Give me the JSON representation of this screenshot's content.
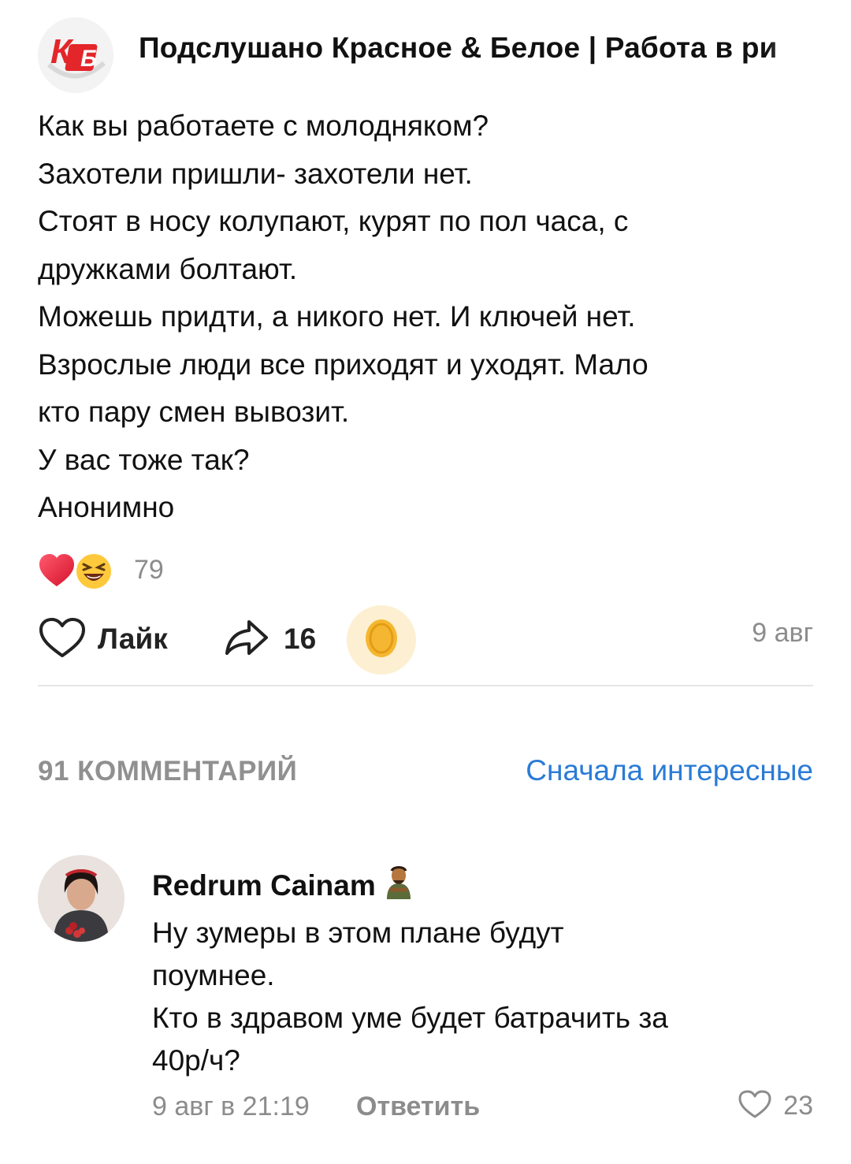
{
  "post": {
    "group_name": "Подслушано Красное & Белое | Работа в ри",
    "logo_text": "КБ",
    "lines": [
      "Как вы работаете с молодняком?",
      "Захотели пришли- захотели нет.",
      "Стоят в носу колупают, курят по пол часа, с",
      "дружками болтают.",
      "Можешь придти, а никого нет. И ключей нет.",
      "Взрослые люди все приходят и уходят. Мало",
      "кто пару смен вывозит.",
      "У вас тоже так?",
      "Анонимно"
    ],
    "reactions": {
      "icons": [
        "heart-emoji",
        "laughing-emoji"
      ],
      "count": "79"
    },
    "like_label": "Лайк",
    "share_count": "16",
    "date": "9 авг"
  },
  "comments": {
    "count_label": "91 КОММЕНТАРИЙ",
    "sort_label": "Сначала интересные",
    "items": [
      {
        "author": "Redrum Cainam",
        "lines": [
          "Ну зумеры в этом плане будут",
          "поумнее.",
          "Кто в здравом уме будет батрачить за",
          "40р/ч?"
        ],
        "meta": "9 авг в 21:19",
        "reply_label": "Ответить",
        "likes": "23"
      }
    ]
  },
  "colors": {
    "accent": "#2a7bd6",
    "muted": "#8c8c8c",
    "logo_red": "#e3262a",
    "donate_bg": "#fdf0d2",
    "coin": "#f5b731"
  }
}
